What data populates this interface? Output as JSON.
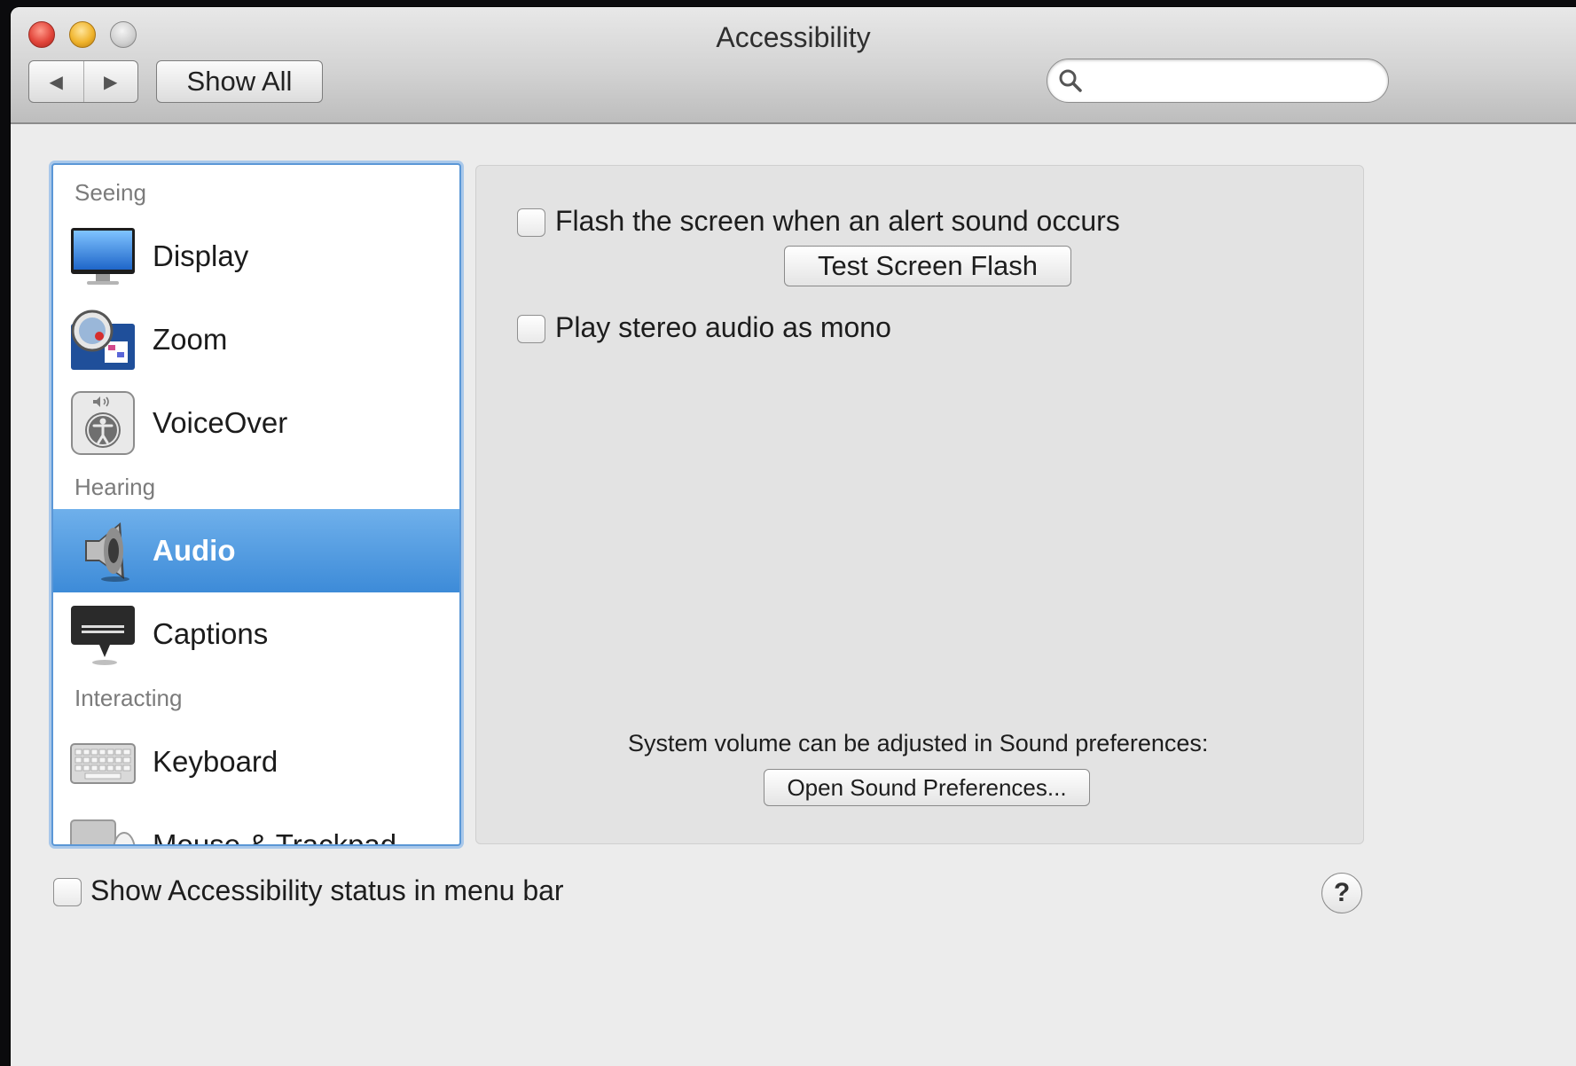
{
  "window": {
    "title": "Accessibility"
  },
  "toolbar": {
    "back_glyph": "◀",
    "forward_glyph": "▶",
    "show_all_label": "Show All",
    "search_value": "",
    "search_placeholder": ""
  },
  "sidebar": {
    "groups": [
      {
        "label": "Seeing"
      },
      {
        "label": "Hearing"
      },
      {
        "label": "Interacting"
      }
    ],
    "items": [
      {
        "label": "Display",
        "icon": "display-icon"
      },
      {
        "label": "Zoom",
        "icon": "zoom-icon"
      },
      {
        "label": "VoiceOver",
        "icon": "voiceover-icon"
      },
      {
        "label": "Audio",
        "icon": "speaker-icon",
        "selected": true
      },
      {
        "label": "Captions",
        "icon": "captions-icon"
      },
      {
        "label": "Keyboard",
        "icon": "keyboard-icon"
      },
      {
        "label": "Mouse & Trackpad",
        "icon": "mouse-trackpad-icon"
      }
    ]
  },
  "audio_pane": {
    "flash_screen_label": "Flash the screen when an alert sound occurs",
    "flash_screen_checked": false,
    "test_flash_button": "Test Screen Flash",
    "mono_audio_label": "Play stereo audio as mono",
    "mono_audio_checked": false,
    "volume_note": "System volume can be adjusted in Sound preferences:",
    "open_sound_button": "Open Sound Preferences..."
  },
  "footer": {
    "status_menu_label": "Show Accessibility status in menu bar",
    "status_menu_checked": false,
    "help_glyph": "?"
  },
  "colors": {
    "selection": "#3d8bd8",
    "focus_ring": "#5b97d6"
  }
}
